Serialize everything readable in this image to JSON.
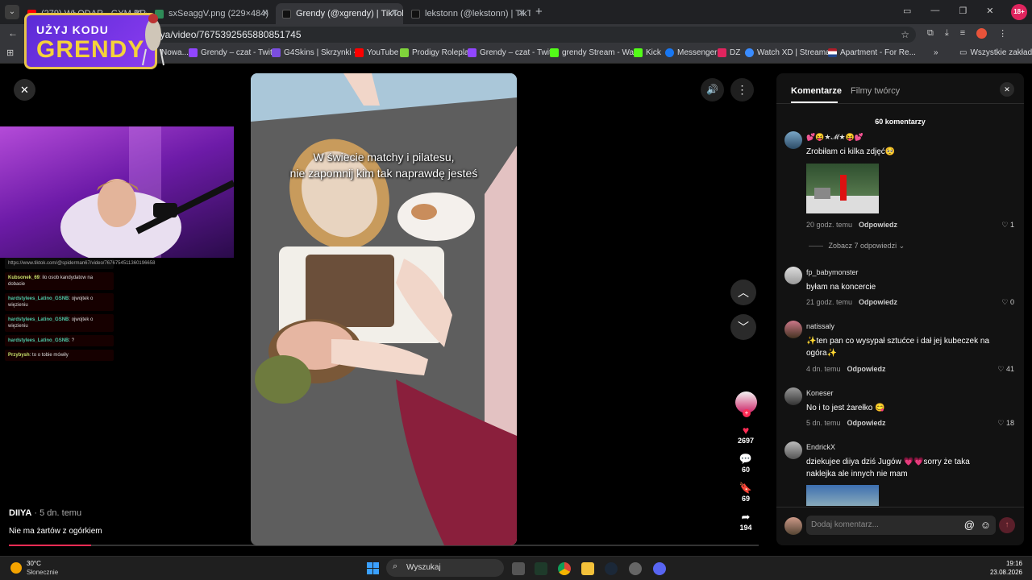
{
  "browser": {
    "tabs": [
      {
        "title": "(279) WŁODAR - GYM BRO (pro...",
        "active": false
      },
      {
        "title": "sxSeaggV.png (229×484)",
        "active": false
      },
      {
        "title": "Grendy (@xgrendy) | TikTok",
        "active": true
      },
      {
        "title": "lekstonn (@lekstonn) | TikTok",
        "active": false
      }
    ],
    "new_tab": "+",
    "url": "iya/video/7675392565880851745",
    "bookmarks": [
      "Nowa...",
      "Grendy – czat - Twit...",
      "G4Skins | Skrzynki -...",
      "YouTube",
      "Prodigy Roleplay",
      "Grendy – czat - Twit...",
      "grendy Stream - Wa...",
      "Kick",
      "Messenger",
      "DZ",
      "Watch XD | Streama...",
      "Apartment - For Re..."
    ],
    "bookmarks_more": "»",
    "all_bookmarks": "Wszystkie zakładki",
    "age_badge": "18+"
  },
  "promo": {
    "line1": "UŻYJ KODU",
    "line2": "GRENDY"
  },
  "stream": {
    "chat_link": "https://www.tiktok.com/@spiderman67/video/7676754511360196658",
    "chat": [
      {
        "user": "Kubsonek_69",
        "text": "ilo osob kandydatow na dobacie",
        "style": "u2"
      },
      {
        "user": "hardstylees_Latino_GSNB",
        "text": "ojwojtek o więzieniu",
        "style": "u1"
      },
      {
        "user": "hardstylees_Latino_GSNB",
        "text": "ojwojtek o więzieniu",
        "style": "u1"
      },
      {
        "user": "hardstylees_Latino_GSNB",
        "text": "?",
        "style": "u1"
      },
      {
        "user": "Przybysh",
        "text": "to o tobie mówiły",
        "style": "u2"
      }
    ]
  },
  "video": {
    "caption_line1": "W świecie matchy i pilatesu,",
    "caption_line2": "nie zapomnij kim tak naprawdę jesteś",
    "author": "DIIYA",
    "posted": "· 5 dn. temu",
    "description": "Nie ma żartów z ogórkiem",
    "likes": "2697",
    "comments": "60",
    "saves": "69",
    "shares": "194"
  },
  "panel": {
    "tab_comments": "Komentarze",
    "tab_creator": "Filmy twórcy",
    "count_label": "60 komentarzy",
    "view_replies": "Zobacz 7 odpowiedzi",
    "reply_label": "Odpowiedz",
    "input_placeholder": "Dodaj komentarz...",
    "comments": [
      {
        "user": "💕😝★𝓜★😝💕",
        "text": "Zrobiłam ci kilka zdjęć🥺",
        "time": "20 godz. temu",
        "likes": "1"
      },
      {
        "user": "fp_babymonster",
        "text": "byłam na koncercie",
        "time": "21 godz. temu",
        "likes": "0"
      },
      {
        "user": "natissaly",
        "text": "✨ten pan co wysypał sztućce i dał jej kubeczek na ogóra✨",
        "time": "4 dn. temu",
        "likes": "41"
      },
      {
        "user": "Koneser",
        "text": "No i to jest żarełko 😋",
        "time": "5 dn. temu",
        "likes": "18"
      },
      {
        "user": "EndrickX",
        "text": "dziekujee diiya dziś Jugów 💗💗sorry że taka naklejka ale innych nie mam",
        "time": "",
        "likes": ""
      }
    ]
  },
  "taskbar": {
    "temp": "30°C",
    "weather": "Słonecznie",
    "search": "Wyszukaj",
    "time": "19:16",
    "date": "23.08.2026"
  },
  "colors": {
    "accent": "#fe2c55",
    "promo": "#7a36e8",
    "gold": "#f5d23a"
  }
}
